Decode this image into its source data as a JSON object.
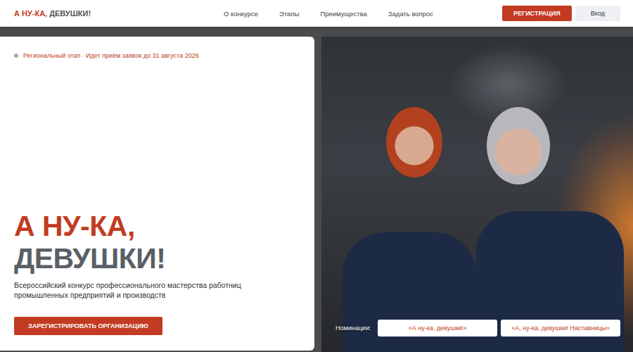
{
  "header": {
    "logo": {
      "accent": "А НУ-КА,",
      "rest": "ДЕВУШКИ!"
    },
    "nav": [
      "О конкурсе",
      "Этапы",
      "Преимущества",
      "Задать вопрос"
    ],
    "register_button": "РЕГИСТРАЦИЯ",
    "login_button": "Вход"
  },
  "hero": {
    "badge": "Региональный этап · Идет приём заявок до 31 августа 2026",
    "title_line1": "А НУ-КА,",
    "title_line2": "ДЕВУШКИ!",
    "description": "Всероссийский конкурс профессионального мастерства работниц промышленных предприятий и производств",
    "cta": "ЗАРЕГИСТРИРОВАТЬ ОРГАНИЗАЦИЮ"
  },
  "photo": {
    "nominations_label": "Номинации:",
    "nominations": [
      "«А ну-ка, девушки!»",
      "«А, ну-ка, девушки! Наставницы»"
    ]
  }
}
